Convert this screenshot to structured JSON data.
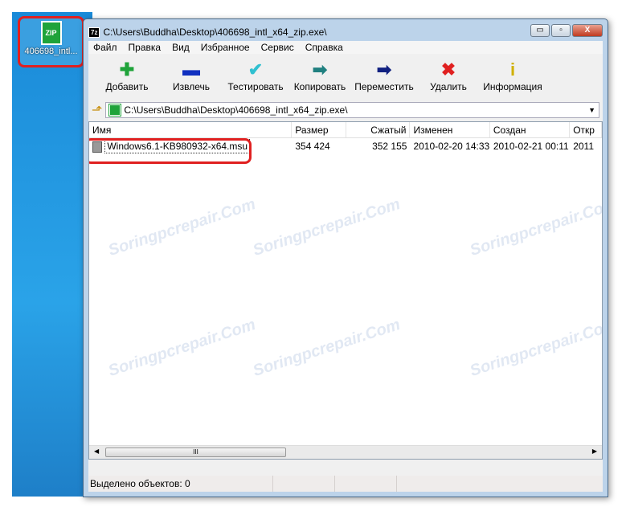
{
  "desktop": {
    "icon_label": "406698_intl...",
    "icon_glyph": "ZIP"
  },
  "window": {
    "app_icon": "7z",
    "title": "C:\\Users\\Buddha\\Desktop\\406698_intl_x64_zip.exe\\",
    "min": "▭",
    "max": "▫",
    "close": "X"
  },
  "menu": [
    "Файл",
    "Правка",
    "Вид",
    "Избранное",
    "Сервис",
    "Справка"
  ],
  "toolbar": [
    {
      "label": "Добавить",
      "icon": "plus-icon",
      "glyph": "✚",
      "color": "#1fa33a"
    },
    {
      "label": "Извлечь",
      "icon": "minus-icon",
      "glyph": "▬",
      "color": "#1030c0"
    },
    {
      "label": "Тестировать",
      "icon": "check-icon",
      "glyph": "✔",
      "color": "#30c0d0"
    },
    {
      "label": "Копировать",
      "icon": "copy-arrow-icon",
      "glyph": "➡",
      "color": "#208080"
    },
    {
      "label": "Переместить",
      "icon": "move-arrow-icon",
      "glyph": "➡",
      "color": "#102080"
    },
    {
      "label": "Удалить",
      "icon": "delete-icon",
      "glyph": "✖",
      "color": "#e02020"
    },
    {
      "label": "Информация",
      "icon": "info-icon",
      "glyph": "i",
      "color": "#d0b000"
    }
  ],
  "address": {
    "path": "C:\\Users\\Buddha\\Desktop\\406698_intl_x64_zip.exe\\"
  },
  "columns": [
    "Имя",
    "Размер",
    "Сжатый",
    "Изменен",
    "Создан",
    "Откр"
  ],
  "rows": [
    {
      "name": "Windows6.1-KB980932-x64.msu",
      "size": "354 424",
      "packed": "352 155",
      "modified": "2010-02-20 14:33",
      "created": "2010-02-21 00:11",
      "accessed": "2011"
    }
  ],
  "status": {
    "text": "Выделено объектов: 0"
  },
  "watermark": "Soringpcrepair.Com"
}
